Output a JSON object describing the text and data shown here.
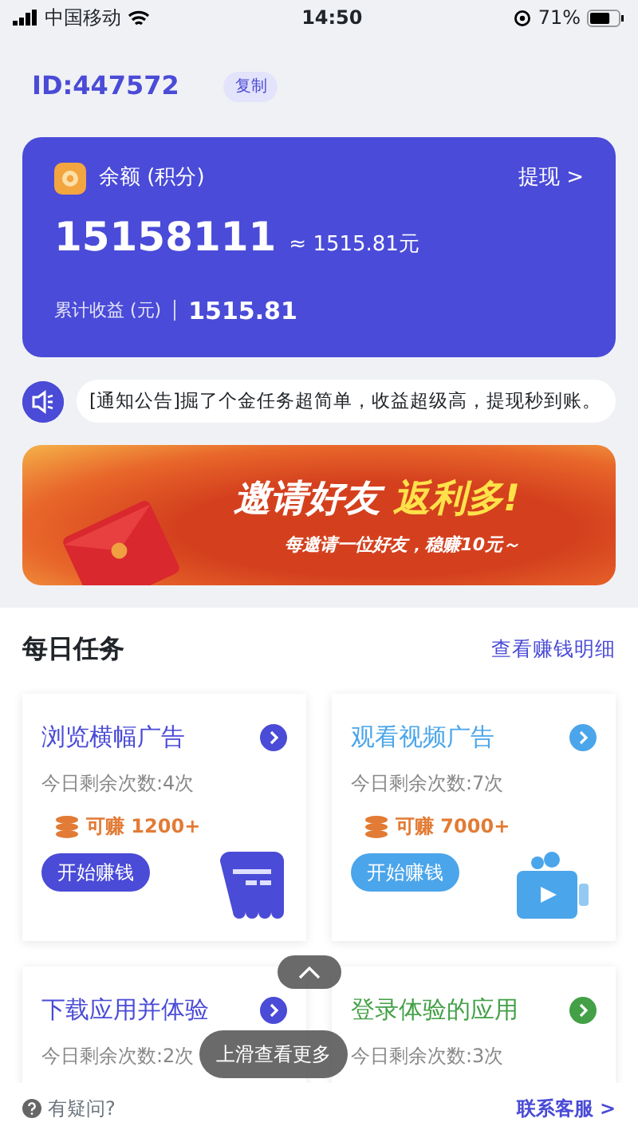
{
  "status_bar": {
    "carrier": "中国移动",
    "time": "14:50",
    "battery": "71%"
  },
  "account": {
    "id": "ID:447572",
    "copy_button": "复制"
  },
  "balance_card": {
    "label": "余额 (积分)",
    "withdraw": "提现 >",
    "points": "15158111",
    "approx": "≈ 1515.81元",
    "total_label": "累计收益 (元)",
    "total_value": "1515.81"
  },
  "notice": "[通知公告]掘了个金任务超简单，收益超级高，提现秒到账。",
  "banner": {
    "title": "邀请好友",
    "highlight": "返利多!",
    "subtitle": "每邀请一位好友，稳赚10元～"
  },
  "daily_tasks": {
    "title": "每日任务",
    "details_link": "查看赚钱明细",
    "tasks": [
      {
        "title": "浏览横幅广告",
        "color": "#4a4bd6",
        "remaining": "今日剩余次数:4次",
        "earn": "可赚 1200+",
        "button": "开始赚钱",
        "kind": "banner"
      },
      {
        "title": "观看视频广告",
        "color": "#4ba5ea",
        "remaining": "今日剩余次数:7次",
        "earn": "可赚 7000+",
        "button": "开始赚钱",
        "kind": "video"
      },
      {
        "title": "下载应用并体验",
        "color": "#4a4bd6",
        "remaining": "今日剩余次数:2次",
        "kind": "none"
      },
      {
        "title": "登录体验的应用",
        "color": "#43a047",
        "remaining": "今日剩余次数:3次",
        "kind": "none"
      }
    ]
  },
  "scroll_hint": {
    "text": "上滑查看更多"
  },
  "footer": {
    "help": "有疑问?",
    "contact": "联系客服 >"
  }
}
